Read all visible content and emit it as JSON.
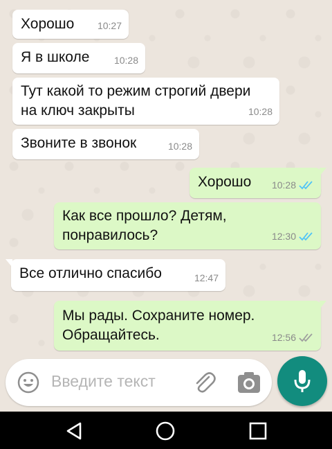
{
  "messages": [
    {
      "direction": "in",
      "text": "Хорошо",
      "time": "10:27"
    },
    {
      "direction": "in",
      "text": "Я в школе",
      "time": "10:28"
    },
    {
      "direction": "in",
      "text": "Тут какой то режим строгий двери\nна ключ закрыты",
      "time": "10:28"
    },
    {
      "direction": "in",
      "text": "Звоните в звонок",
      "time": "10:28"
    },
    {
      "direction": "out",
      "text": "Хорошо",
      "time": "10:28",
      "status": "read"
    },
    {
      "direction": "out",
      "text": "Как все прошло? Детям,\nпонравилось?",
      "time": "12:30",
      "status": "read"
    },
    {
      "direction": "in",
      "text": "Все отлично спасибо",
      "time": "12:47"
    },
    {
      "direction": "out",
      "text": "Мы рады. Сохраните номер.\nОбращайтесь.",
      "time": "12:56",
      "status": "delivered"
    }
  ],
  "composer": {
    "placeholder": "Введите текст",
    "emoji_icon": "emoji-icon",
    "attach_icon": "paperclip-icon",
    "camera_icon": "camera-icon",
    "mic_icon": "microphone-icon"
  },
  "navbar": {
    "back_icon": "back-triangle-icon",
    "home_icon": "home-circle-icon",
    "recents_icon": "recents-square-icon"
  },
  "colors": {
    "incoming_bubble": "#ffffff",
    "outgoing_bubble": "#dcf8c6",
    "read_tick": "#4fc3f7",
    "delivered_tick": "#9e9e9e",
    "mic_button": "#128c7e",
    "chat_background": "#ece5dd"
  }
}
